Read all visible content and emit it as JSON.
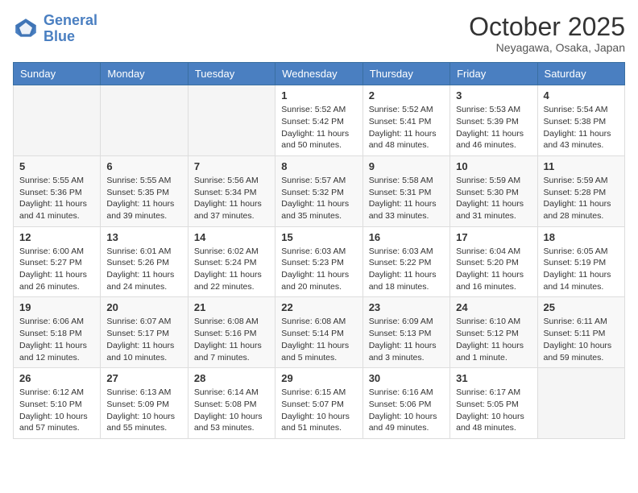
{
  "header": {
    "logo_line1": "General",
    "logo_line2": "Blue",
    "month_title": "October 2025",
    "subtitle": "Neyagawa, Osaka, Japan"
  },
  "days_of_week": [
    "Sunday",
    "Monday",
    "Tuesday",
    "Wednesday",
    "Thursday",
    "Friday",
    "Saturday"
  ],
  "weeks": [
    [
      {
        "day": "",
        "info": ""
      },
      {
        "day": "",
        "info": ""
      },
      {
        "day": "",
        "info": ""
      },
      {
        "day": "1",
        "info": "Sunrise: 5:52 AM\nSunset: 5:42 PM\nDaylight: 11 hours\nand 50 minutes."
      },
      {
        "day": "2",
        "info": "Sunrise: 5:52 AM\nSunset: 5:41 PM\nDaylight: 11 hours\nand 48 minutes."
      },
      {
        "day": "3",
        "info": "Sunrise: 5:53 AM\nSunset: 5:39 PM\nDaylight: 11 hours\nand 46 minutes."
      },
      {
        "day": "4",
        "info": "Sunrise: 5:54 AM\nSunset: 5:38 PM\nDaylight: 11 hours\nand 43 minutes."
      }
    ],
    [
      {
        "day": "5",
        "info": "Sunrise: 5:55 AM\nSunset: 5:36 PM\nDaylight: 11 hours\nand 41 minutes."
      },
      {
        "day": "6",
        "info": "Sunrise: 5:55 AM\nSunset: 5:35 PM\nDaylight: 11 hours\nand 39 minutes."
      },
      {
        "day": "7",
        "info": "Sunrise: 5:56 AM\nSunset: 5:34 PM\nDaylight: 11 hours\nand 37 minutes."
      },
      {
        "day": "8",
        "info": "Sunrise: 5:57 AM\nSunset: 5:32 PM\nDaylight: 11 hours\nand 35 minutes."
      },
      {
        "day": "9",
        "info": "Sunrise: 5:58 AM\nSunset: 5:31 PM\nDaylight: 11 hours\nand 33 minutes."
      },
      {
        "day": "10",
        "info": "Sunrise: 5:59 AM\nSunset: 5:30 PM\nDaylight: 11 hours\nand 31 minutes."
      },
      {
        "day": "11",
        "info": "Sunrise: 5:59 AM\nSunset: 5:28 PM\nDaylight: 11 hours\nand 28 minutes."
      }
    ],
    [
      {
        "day": "12",
        "info": "Sunrise: 6:00 AM\nSunset: 5:27 PM\nDaylight: 11 hours\nand 26 minutes."
      },
      {
        "day": "13",
        "info": "Sunrise: 6:01 AM\nSunset: 5:26 PM\nDaylight: 11 hours\nand 24 minutes."
      },
      {
        "day": "14",
        "info": "Sunrise: 6:02 AM\nSunset: 5:24 PM\nDaylight: 11 hours\nand 22 minutes."
      },
      {
        "day": "15",
        "info": "Sunrise: 6:03 AM\nSunset: 5:23 PM\nDaylight: 11 hours\nand 20 minutes."
      },
      {
        "day": "16",
        "info": "Sunrise: 6:03 AM\nSunset: 5:22 PM\nDaylight: 11 hours\nand 18 minutes."
      },
      {
        "day": "17",
        "info": "Sunrise: 6:04 AM\nSunset: 5:20 PM\nDaylight: 11 hours\nand 16 minutes."
      },
      {
        "day": "18",
        "info": "Sunrise: 6:05 AM\nSunset: 5:19 PM\nDaylight: 11 hours\nand 14 minutes."
      }
    ],
    [
      {
        "day": "19",
        "info": "Sunrise: 6:06 AM\nSunset: 5:18 PM\nDaylight: 11 hours\nand 12 minutes."
      },
      {
        "day": "20",
        "info": "Sunrise: 6:07 AM\nSunset: 5:17 PM\nDaylight: 11 hours\nand 10 minutes."
      },
      {
        "day": "21",
        "info": "Sunrise: 6:08 AM\nSunset: 5:16 PM\nDaylight: 11 hours\nand 7 minutes."
      },
      {
        "day": "22",
        "info": "Sunrise: 6:08 AM\nSunset: 5:14 PM\nDaylight: 11 hours\nand 5 minutes."
      },
      {
        "day": "23",
        "info": "Sunrise: 6:09 AM\nSunset: 5:13 PM\nDaylight: 11 hours\nand 3 minutes."
      },
      {
        "day": "24",
        "info": "Sunrise: 6:10 AM\nSunset: 5:12 PM\nDaylight: 11 hours\nand 1 minute."
      },
      {
        "day": "25",
        "info": "Sunrise: 6:11 AM\nSunset: 5:11 PM\nDaylight: 10 hours\nand 59 minutes."
      }
    ],
    [
      {
        "day": "26",
        "info": "Sunrise: 6:12 AM\nSunset: 5:10 PM\nDaylight: 10 hours\nand 57 minutes."
      },
      {
        "day": "27",
        "info": "Sunrise: 6:13 AM\nSunset: 5:09 PM\nDaylight: 10 hours\nand 55 minutes."
      },
      {
        "day": "28",
        "info": "Sunrise: 6:14 AM\nSunset: 5:08 PM\nDaylight: 10 hours\nand 53 minutes."
      },
      {
        "day": "29",
        "info": "Sunrise: 6:15 AM\nSunset: 5:07 PM\nDaylight: 10 hours\nand 51 minutes."
      },
      {
        "day": "30",
        "info": "Sunrise: 6:16 AM\nSunset: 5:06 PM\nDaylight: 10 hours\nand 49 minutes."
      },
      {
        "day": "31",
        "info": "Sunrise: 6:17 AM\nSunset: 5:05 PM\nDaylight: 10 hours\nand 48 minutes."
      },
      {
        "day": "",
        "info": ""
      }
    ]
  ]
}
